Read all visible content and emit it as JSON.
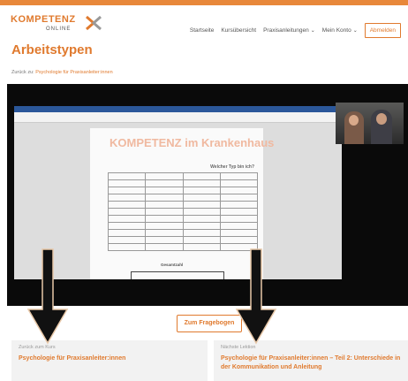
{
  "header": {
    "logo_text": "KOMPETENZ",
    "logo_sub": "ONLINE",
    "nav": [
      {
        "label": "Startseite",
        "dropdown": false
      },
      {
        "label": "Kursübersicht",
        "dropdown": false
      },
      {
        "label": "Praxisanleitungen",
        "dropdown": true
      },
      {
        "label": "Mein Konto",
        "dropdown": true
      }
    ],
    "logout_label": "Abmelden"
  },
  "page": {
    "title": "Arbeitstypen",
    "back_prefix": "Zurück zu:",
    "back_link": "Psychologie für Praxisanleiter:innen"
  },
  "video": {
    "doc_title": "KOMPETENZ im Krankenhaus",
    "doc_question": "Welcher Typ bin ich?",
    "doc_total": "Gesamtzahl"
  },
  "quiz_button": "Zum Fragebogen",
  "prev_card": {
    "small": "Zurück zum Kurs",
    "title": "Psychologie für Praxisanleiter:innen"
  },
  "next_card": {
    "small": "Nächste Lektion",
    "title": "Psychologie für Praxisanleiter:innen – Teil 2: Unterschiede in der Kommunikation und Anleitung"
  },
  "colors": {
    "accent": "#e07a2e",
    "topbar": "#e8883a",
    "video_bg": "#0a0a0a"
  },
  "icons": [
    "logo-x-icon",
    "chevron-down-icon",
    "down-arrow-icon"
  ]
}
